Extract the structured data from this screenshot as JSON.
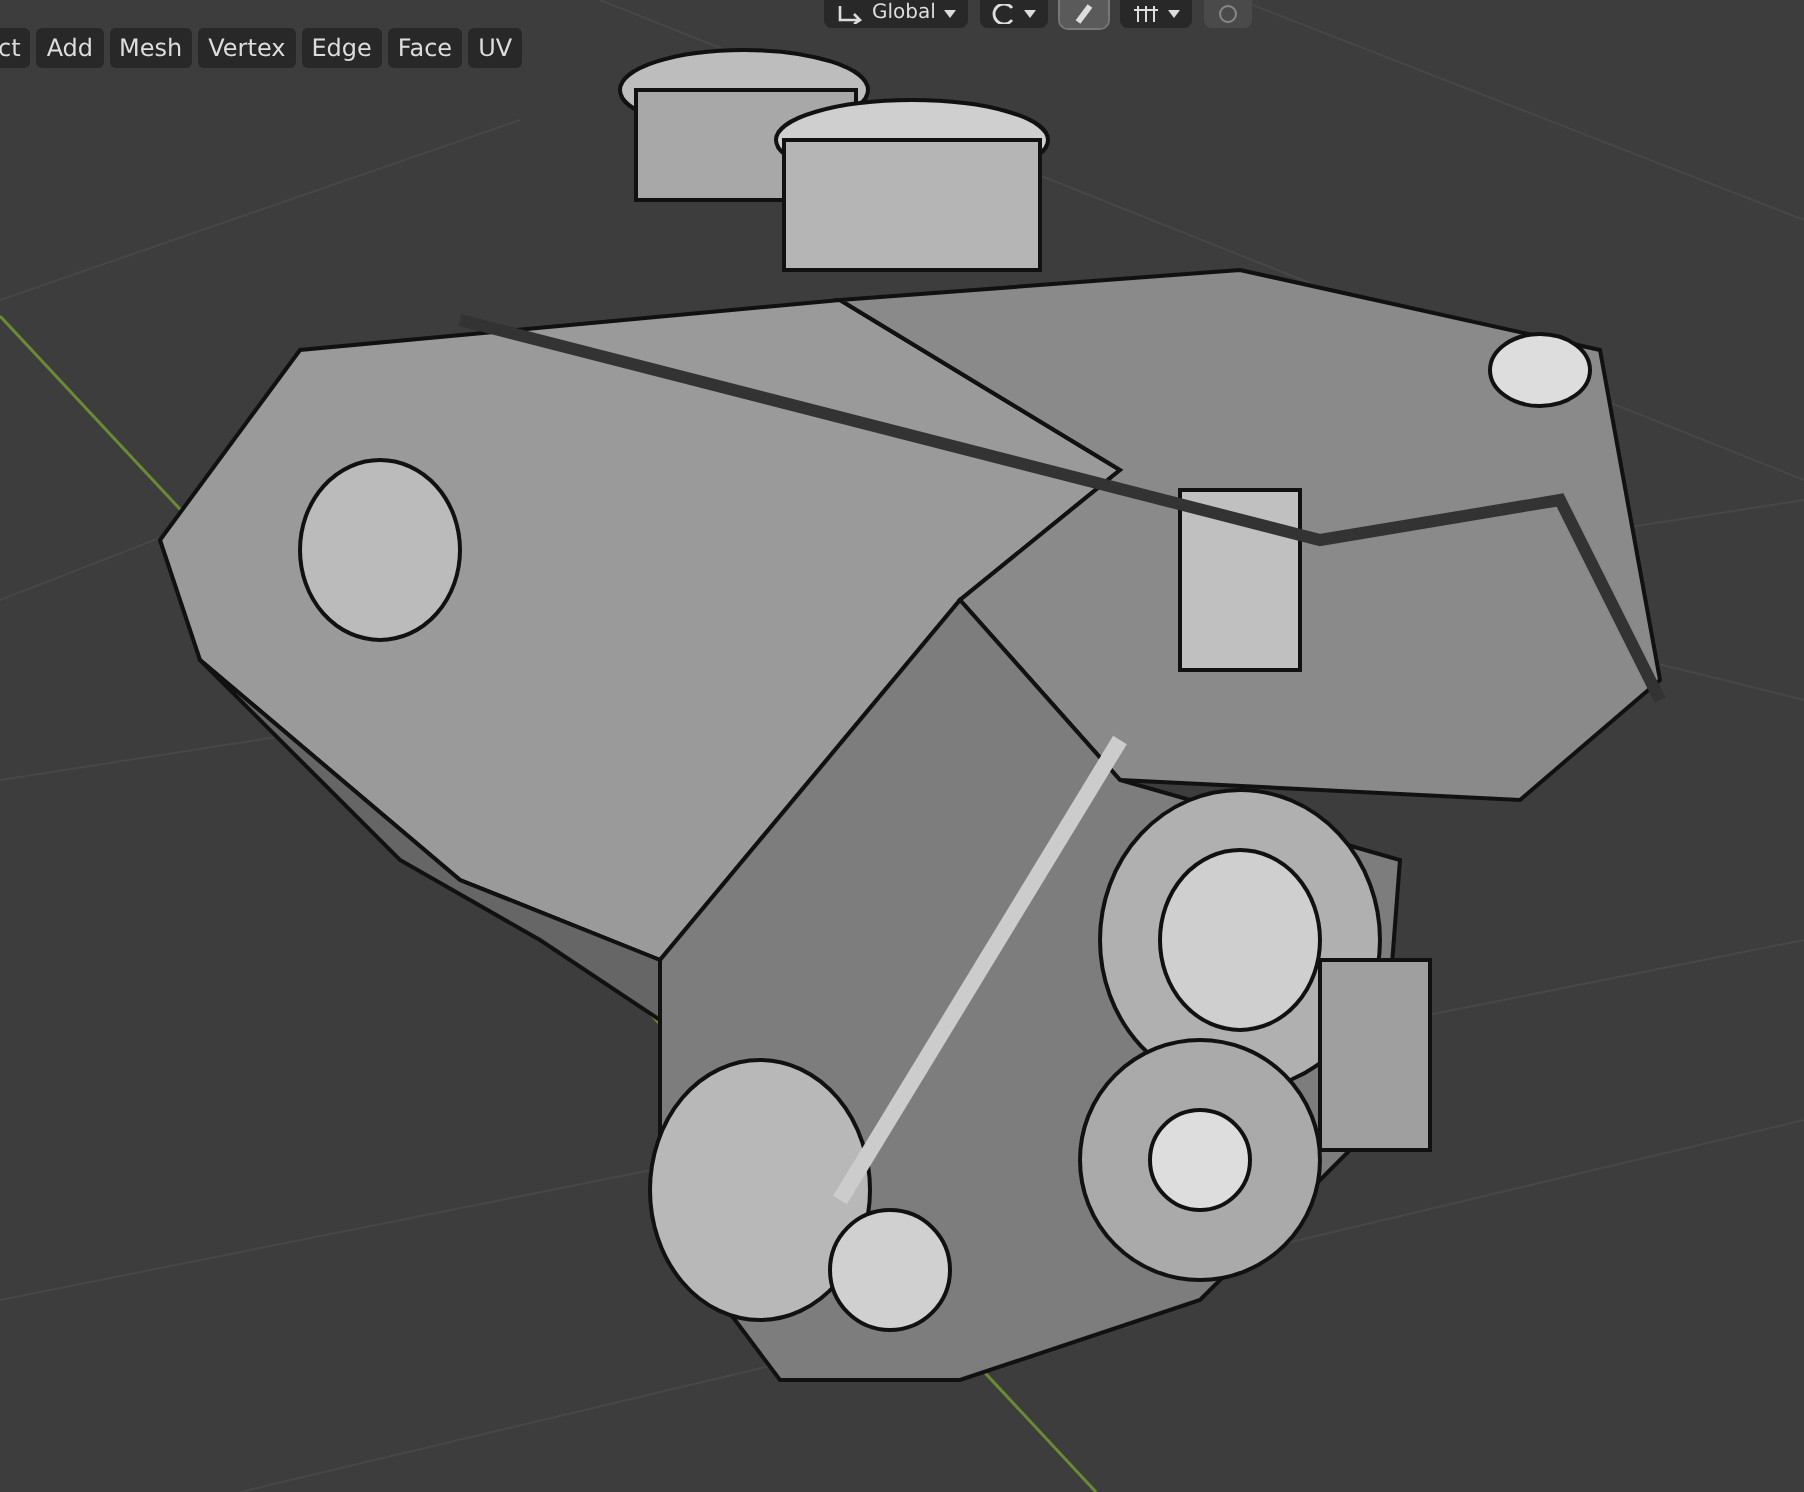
{
  "header": {
    "orientation": "Global",
    "toggles": [
      {
        "kind": "snap",
        "on": true
      },
      {
        "kind": "proportional",
        "on": false
      }
    ]
  },
  "menu": [
    "ct",
    "Add",
    "Mesh",
    "Vertex",
    "Edge",
    "Face",
    "UV"
  ]
}
